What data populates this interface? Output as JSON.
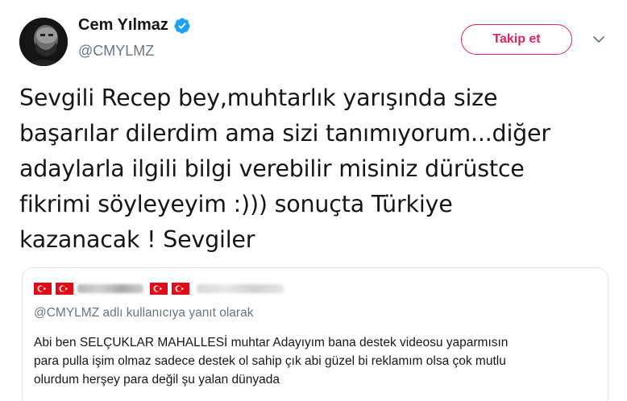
{
  "author": {
    "display_name": "Cem Yılmaz",
    "handle": "@CMYLMZ",
    "verified": true,
    "avatar_icon": "profile-photo"
  },
  "actions": {
    "follow_label": "Takip et",
    "more_icon": "chevron-down-icon",
    "follow_color": "#e0245e"
  },
  "tweet": {
    "text": "Sevgili Recep bey,muhtarlık yarışında size\nbaşarılar dilerdim ama sizi tanımıyorum...diğer\nadaylarla ilgili bilgi verebilir misiniz dürüstce\nfikrimi söyleyeyim :))) sonuçta Türkiye\nkazanacak ! Sevgiler"
  },
  "quoted_tweet": {
    "user_name_blurred": true,
    "flags": [
      "turkish-flag-icon",
      "turkish-flag-icon",
      "turkish-flag-icon",
      "turkish-flag-icon"
    ],
    "reply_context": "@CMYLMZ adlı kullanıcıya yanıt olarak",
    "text": "Abi ben SELÇUKLAR MAHALLESİ muhtar Adayıyım bana destek videosu yaparmısın\npara pulla işim olmaz sadece destek ol sahip çık abi güzel bi reklamım olsa çok mutlu\nolurdum herşey para değil şu yalan dünyada"
  },
  "colors": {
    "text": "#14171a",
    "secondary": "#657786",
    "verified_blue": "#1da1f2",
    "border": "#e1e8ed",
    "flag_red": "#e30a17"
  }
}
